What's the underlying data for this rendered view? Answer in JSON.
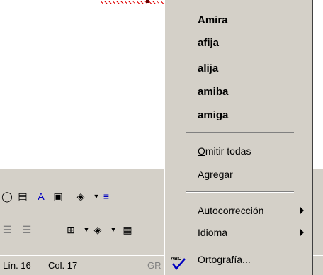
{
  "suggestions": [
    "Amira",
    "afija",
    "alija",
    "amiba",
    "amiga"
  ],
  "menu": {
    "ignore_all": {
      "u": "O",
      "rest": "mitir todas"
    },
    "add": {
      "u": "A",
      "rest": "gregar"
    },
    "autocorrect": {
      "u": "A",
      "rest": "utocorrección"
    },
    "language": {
      "u": "I",
      "rest": "dioma"
    },
    "spelling": {
      "pre": "Ortogr",
      "u": "a",
      "rest": "fía..."
    }
  },
  "status": {
    "line": "Lín. 16",
    "col": "Col. 17",
    "gr": "GR"
  },
  "icons": {
    "misspelling-squiggle": "red wavy underline",
    "spelling-icon": "ABC with check",
    "submenu-arrow": "right arrow"
  },
  "colors": {
    "menu_bg": "#d4d0c8",
    "squiggle": "#e00000",
    "check": "#0000c0"
  }
}
